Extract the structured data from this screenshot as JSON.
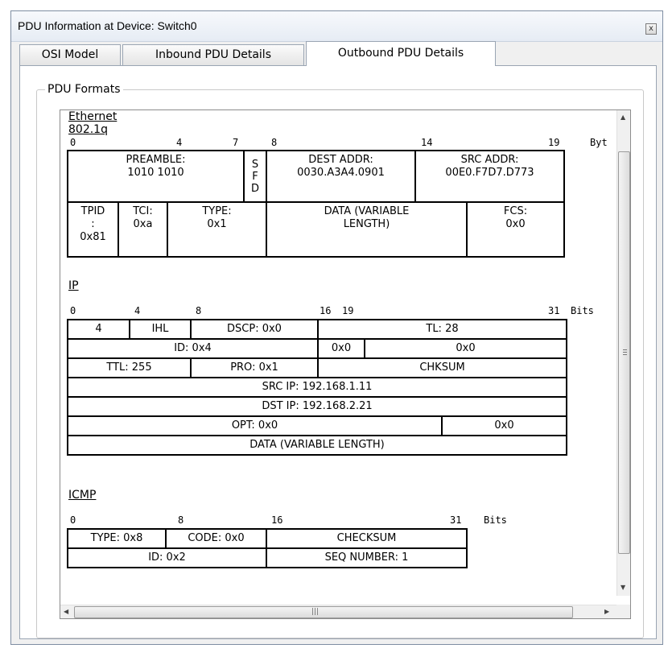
{
  "window": {
    "title": "PDU Information at Device: Switch0",
    "close_label": "x"
  },
  "tabs": [
    {
      "label": "OSI Model",
      "active": false
    },
    {
      "label": "Inbound PDU Details",
      "active": false
    },
    {
      "label": "Outbound PDU Details",
      "active": true
    }
  ],
  "group": {
    "label": "PDU Formats"
  },
  "ethernet": {
    "title": "Ethernet 802.1q",
    "ruler": [
      "0",
      "4",
      "7",
      "8",
      "14",
      "19",
      "Byt"
    ],
    "row1": {
      "preamble": "PREAMBLE:\n1010 1010",
      "sfd": "S\nF\nD",
      "dest": "DEST ADDR:\n0030.A3A4.0901",
      "src": "SRC ADDR:\n00E0.F7D7.D773"
    },
    "row2": {
      "tpid": "TPID\n:\n0x81",
      "tci": "TCI:\n0xa",
      "type": "TYPE:\n0x1",
      "data": "DATA (VARIABLE\nLENGTH)",
      "fcs": "FCS:\n0x0"
    }
  },
  "ip": {
    "title": "IP",
    "ruler": [
      "0",
      "4",
      "8",
      "16",
      "19",
      "31",
      "Bits"
    ],
    "version": "4",
    "ihl": "IHL",
    "dscp": "DSCP: 0x0",
    "tl": "TL: 28",
    "id": "ID: 0x4",
    "flags": "0x0",
    "frag": "0x0",
    "ttl": "TTL: 255",
    "pro": "PRO: 0x1",
    "chksum": "CHKSUM",
    "src_ip": "SRC IP: 192.168.1.11",
    "dst_ip": "DST IP: 192.168.2.21",
    "opt": "OPT: 0x0",
    "opt_pad": "0x0",
    "data": "DATA (VARIABLE LENGTH)"
  },
  "icmp": {
    "title": "ICMP",
    "ruler": [
      "0",
      "8",
      "16",
      "31",
      "Bits"
    ],
    "type": "TYPE: 0x8",
    "code": "CODE: 0x0",
    "checksum": "CHECKSUM",
    "id": "ID: 0x2",
    "seq": "SEQ NUMBER: 1"
  },
  "scrollbars": {
    "up": "▲",
    "down": "▼",
    "left": "◀",
    "right": "▶",
    "grip": "|||"
  }
}
